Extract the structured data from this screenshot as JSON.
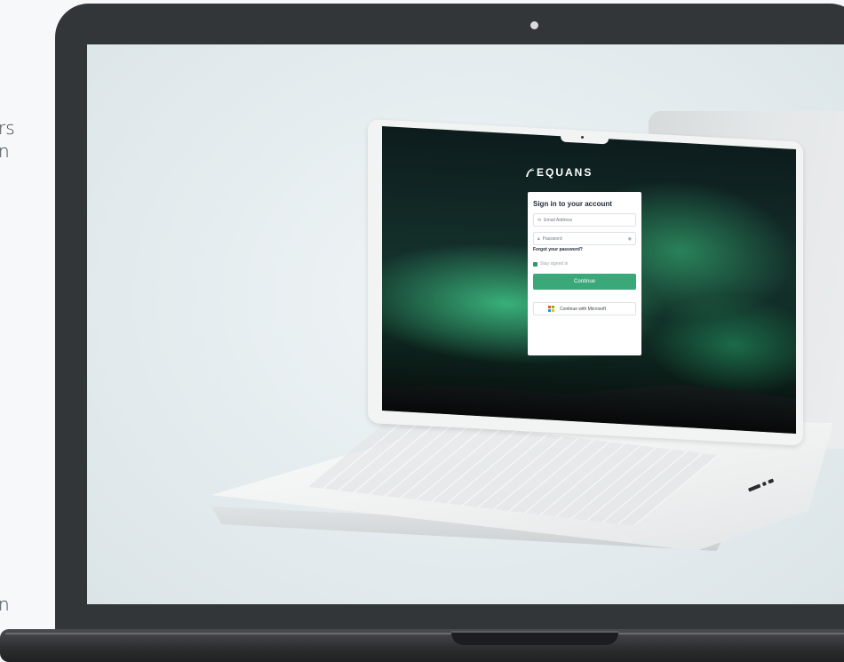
{
  "side_text": {
    "fragment_top_a": "rs",
    "fragment_top_b": "n",
    "fragment_bottom": "n"
  },
  "brand": {
    "name": "EQUANS"
  },
  "login": {
    "title": "Sign in to your account",
    "email_placeholder": "Email Address",
    "password_placeholder": "Password",
    "forgot_link": "Forgot your password?",
    "stay_signed_in": "Stay signed in",
    "continue_label": "Continue",
    "microsoft_label": "Continue with Microsoft"
  },
  "icons": {
    "email": "envelope-icon",
    "password": "lock-icon",
    "show_password": "eye-icon",
    "microsoft": "microsoft-logo-icon"
  },
  "colors": {
    "accent_green": "#3aa878",
    "checkbox_green": "#2e9a6c",
    "frame_dark": "#333639",
    "ms_red": "#f25022",
    "ms_green": "#7fba00",
    "ms_blue": "#00a4ef",
    "ms_yellow": "#ffb900"
  }
}
